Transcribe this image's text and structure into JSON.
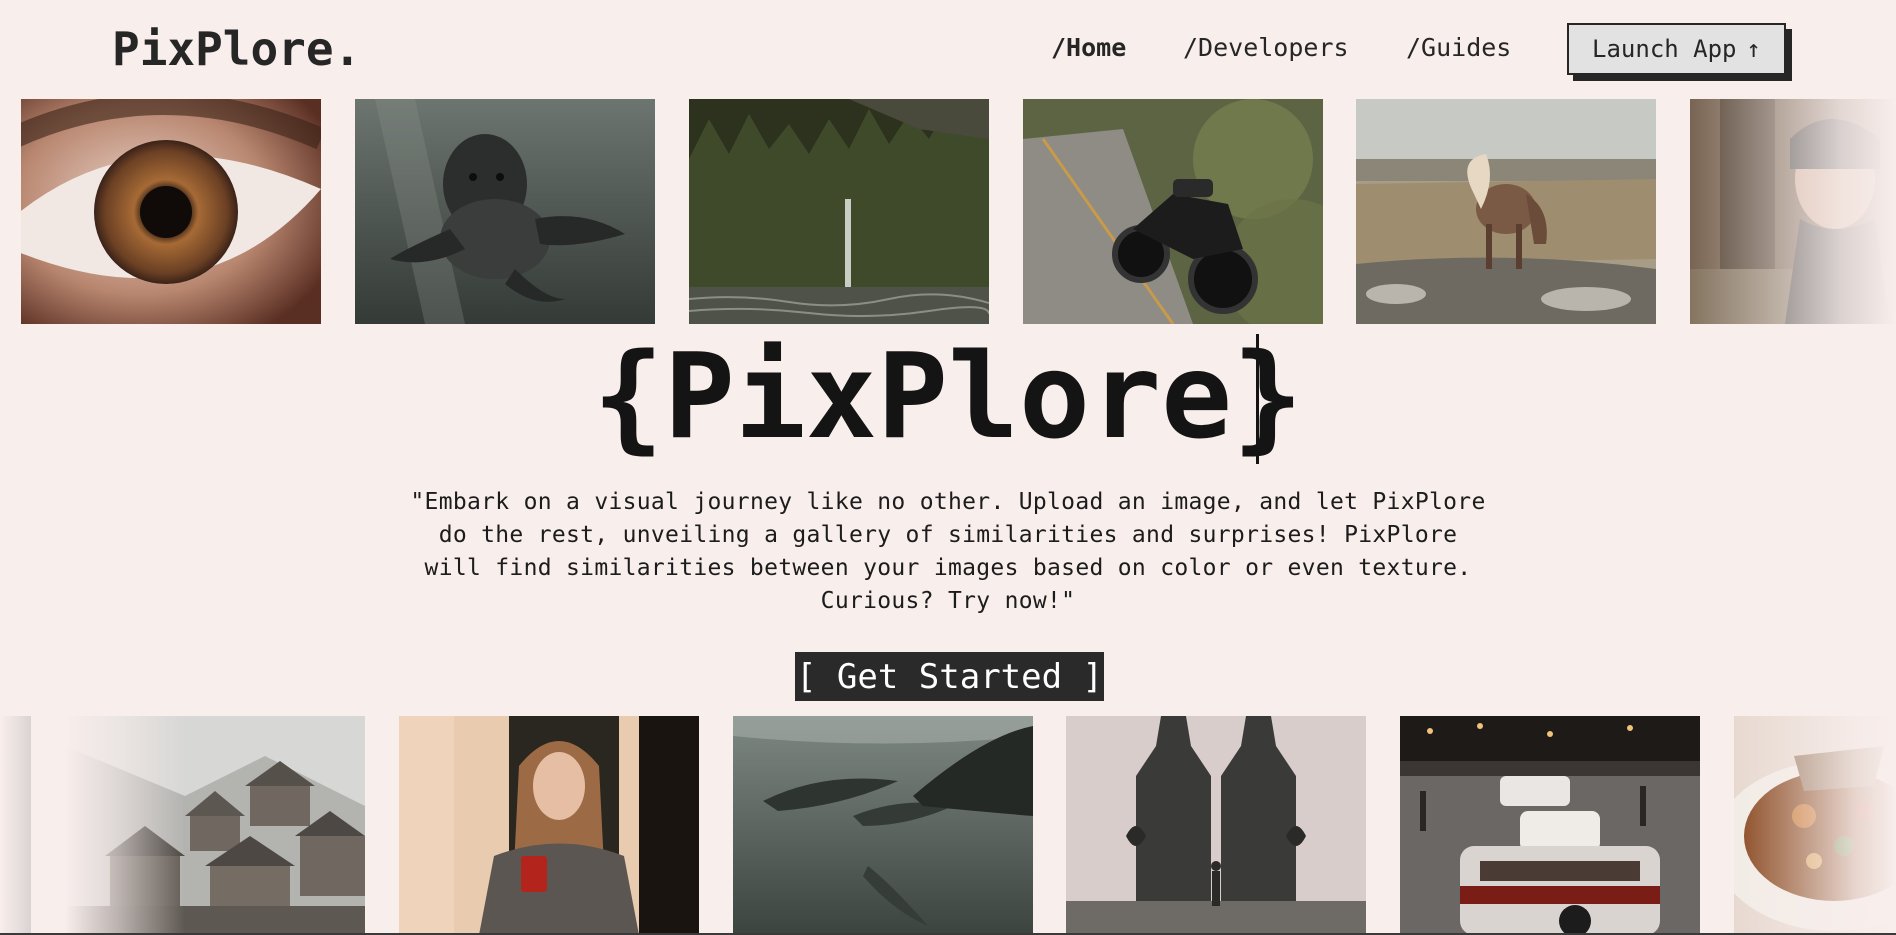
{
  "brand": {
    "logo": "PixPlore."
  },
  "nav": {
    "links": [
      {
        "label": "/Home",
        "active": true
      },
      {
        "label": "/Developers",
        "active": false
      },
      {
        "label": "/Guides",
        "active": false
      }
    ],
    "launch": {
      "label": "Launch App",
      "icon": "arrow-up-icon",
      "glyph": "↑"
    }
  },
  "hero": {
    "title": "{PixPlore}",
    "tagline": "\"Embark on a visual journey like no other. Upload an image, and let PixPlore do the rest, unveiling a gallery of similarities and surprises! PixPlore will find similarities between your images based on color or even texture. Curious? Try now!\"",
    "cta": "[ Get Started ]"
  },
  "gallery": {
    "top": [
      "eye-closeup-photo",
      "seal-underwater-photo",
      "forest-waterfall-photo",
      "motorcycle-road-photo",
      "horse-field-photo",
      "woman-forest-photo"
    ],
    "bottom": [
      "partial-edge-photo",
      "mountain-village-photo",
      "woman-coffee-photo",
      "dolphins-underwater-photo",
      "temple-gate-photo",
      "classic-cars-street-photo",
      "food-plate-photo"
    ]
  },
  "colors": {
    "background": "#f8eeec",
    "ink": "#262626",
    "button": "#2a2a2a",
    "launch_bg": "#e2e2e2"
  }
}
